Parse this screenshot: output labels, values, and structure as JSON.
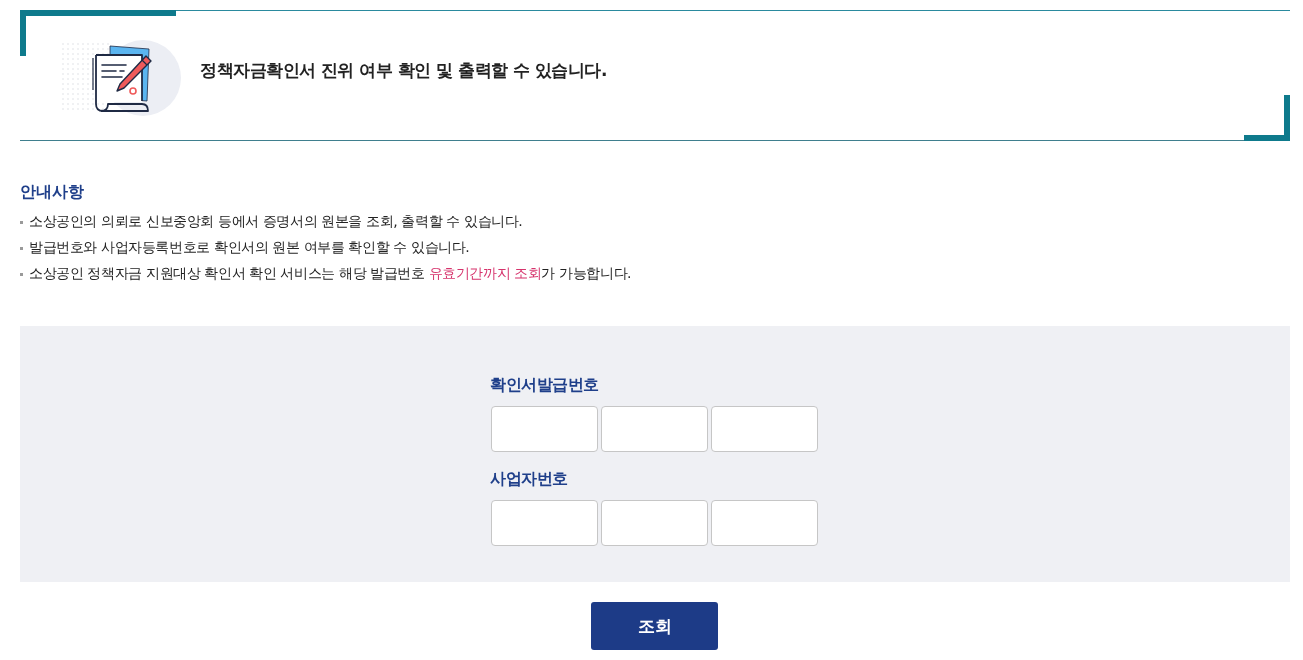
{
  "header": {
    "title": "정책자금확인서 진위 여부 확인 및 출력할 수 있습니다."
  },
  "notice": {
    "heading": "안내사항",
    "items": [
      {
        "segments": [
          {
            "text": "소상공인의 의뢰로 신보중앙회 등에서 증명서의 원본을 조회, 출력할 수 있습니다.",
            "highlight": false
          }
        ]
      },
      {
        "segments": [
          {
            "text": "발급번호와 사업자등록번호로 확인서의 원본 여부를 확인할 수 있습니다.",
            "highlight": false
          }
        ]
      },
      {
        "segments": [
          {
            "text": "소상공인 정책자금 지원대상 확인서 확인 서비스는 해당 발급번호 ",
            "highlight": false
          },
          {
            "text": "유효기간까지 조회",
            "highlight": true
          },
          {
            "text": "가 가능합니다.",
            "highlight": false
          }
        ]
      }
    ]
  },
  "form": {
    "fields": [
      {
        "label": "확인서발급번호",
        "inputs": [
          {
            "kind": "text"
          },
          {
            "kind": "text"
          },
          {
            "kind": "text"
          }
        ]
      },
      {
        "label": "사업자번호",
        "inputs": [
          {
            "kind": "text"
          },
          {
            "kind": "text"
          },
          {
            "kind": "text"
          }
        ]
      }
    ]
  },
  "button": {
    "label": "조회"
  }
}
